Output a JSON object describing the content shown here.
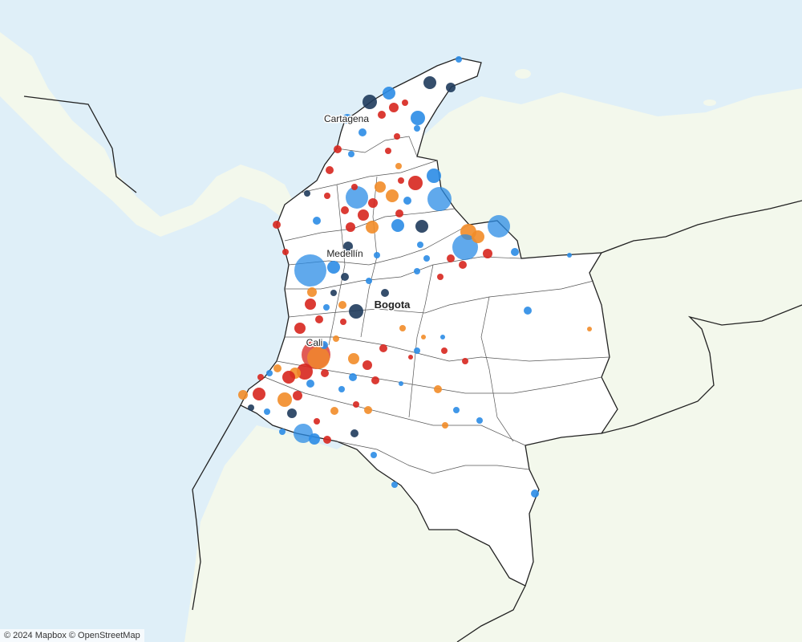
{
  "map": {
    "cities": [
      {
        "name": "Cartagena",
        "bold": false
      },
      {
        "name": "Medellín",
        "bold": false
      },
      {
        "name": "Bogota",
        "bold": true
      },
      {
        "name": "Cali",
        "bold": false
      }
    ],
    "attribution": "© 2024 Mapbox © OpenStreetMap",
    "colors": {
      "water": "#dfeff8",
      "land": "#f3f8ec",
      "colombia": "#ffffff",
      "border": "#222222",
      "markers": {
        "blue": "#2b8ce6",
        "red": "#d7261e",
        "orange": "#f28c28",
        "navy": "#1f3b5c"
      }
    }
  }
}
